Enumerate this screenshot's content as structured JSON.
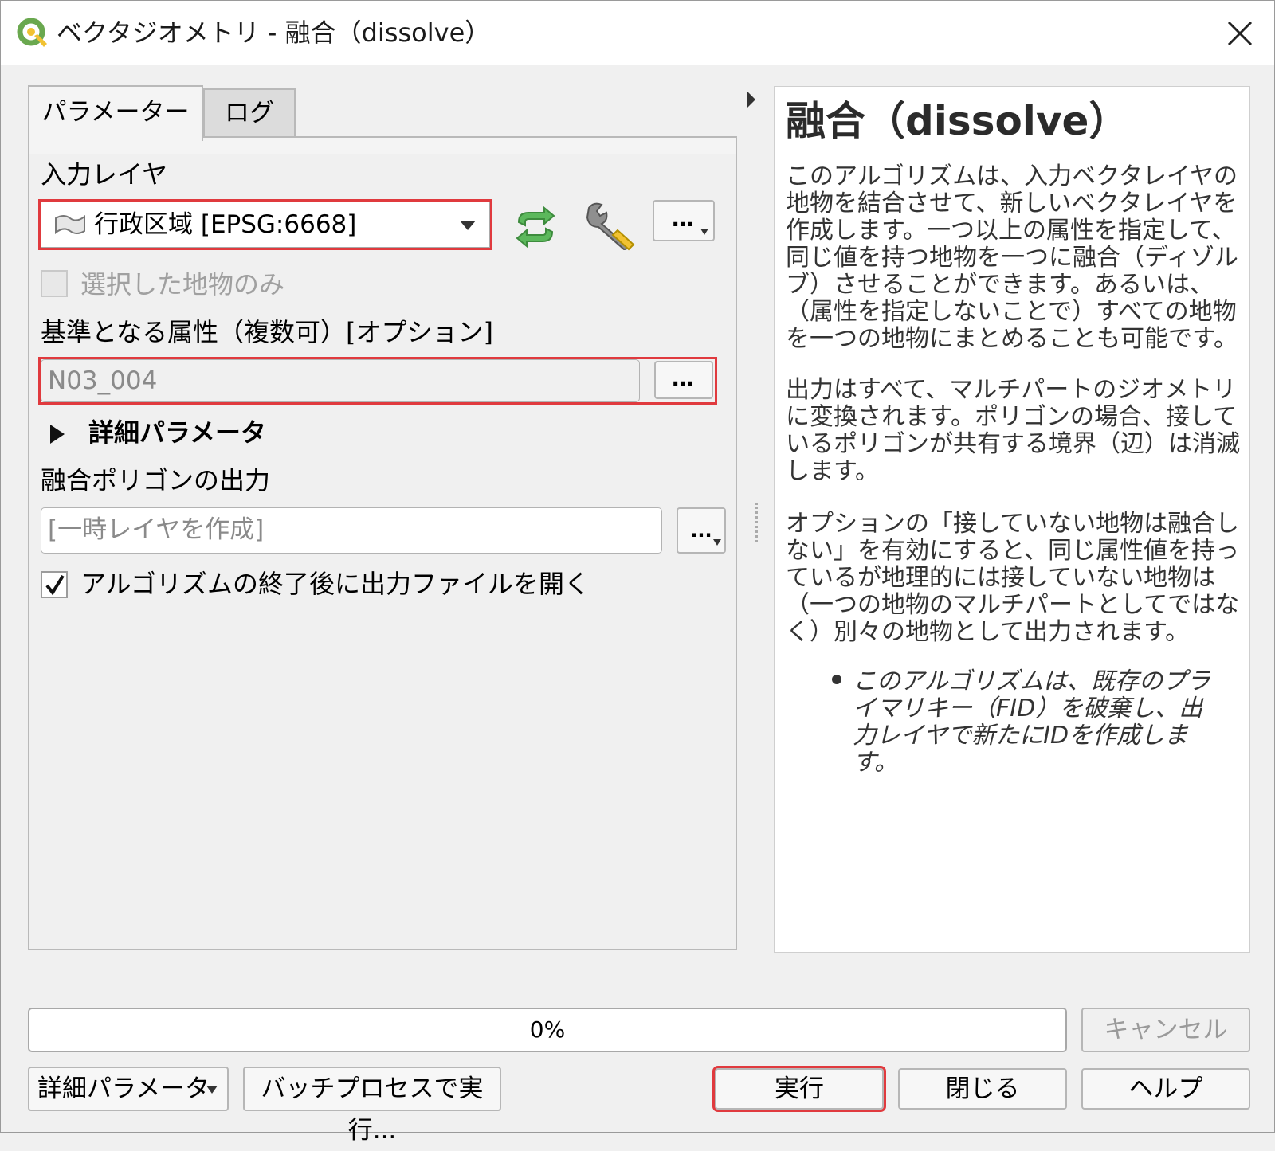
{
  "window": {
    "title": "ベクタジオメトリ - 融合（dissolve）"
  },
  "tabs": [
    {
      "label": "パラメーター"
    },
    {
      "label": "ログ"
    }
  ],
  "params": {
    "input_layer_label": "入力レイヤ",
    "input_layer_value": "行政区域 [EPSG:6668]",
    "selected_only_label": "選択した地物のみ",
    "fields_label": "基準となる属性（複数可）[オプション]",
    "fields_value": "N03_004",
    "advanced_label": "詳細パラメータ",
    "output_label": "融合ポリゴンの出力",
    "output_placeholder": "[一時レイヤを作成]",
    "open_output_label": "アルゴリズムの終了後に出力ファイルを開く",
    "more_button": "…",
    "browse_button": "..."
  },
  "help": {
    "title": "融合（dissolve）",
    "para1": "このアルゴリズムは、入力ベクタレイヤの地物を結合させて、新しいベクタレイヤを作成します。一つ以上の属性を指定して、同じ値を持つ地物を一つに融合（ディゾルブ）させることができます。あるいは、（属性を指定しないことで）すべての地物を一つの地物にまとめることも可能です。",
    "para2": "出力はすべて、マルチパートのジオメトリに変換されます。ポリゴンの場合、接しているポリゴンが共有する境界（辺）は消滅します。",
    "para3": "オプションの「接していない地物は融合しない」を有効にすると、同じ属性値を持っているが地理的には接していない地物は（一つの地物のマルチパートとしてではなく）別々の地物として出力されます。",
    "bullet1": "このアルゴリズムは、既存のプライマリキー（FID）を破棄し、出力レイヤで新たにIDを作成します。"
  },
  "footer": {
    "progress_text": "0%",
    "progress_value": 0,
    "cancel": "キャンセル",
    "advanced": "詳細パラメータ",
    "batch": "バッチプロセスで実行...",
    "run": "実行",
    "close": "閉じる",
    "help": "ヘルプ"
  },
  "colors": {
    "highlight": "#e03a3e",
    "refresh_icon": "#5cb85c"
  }
}
